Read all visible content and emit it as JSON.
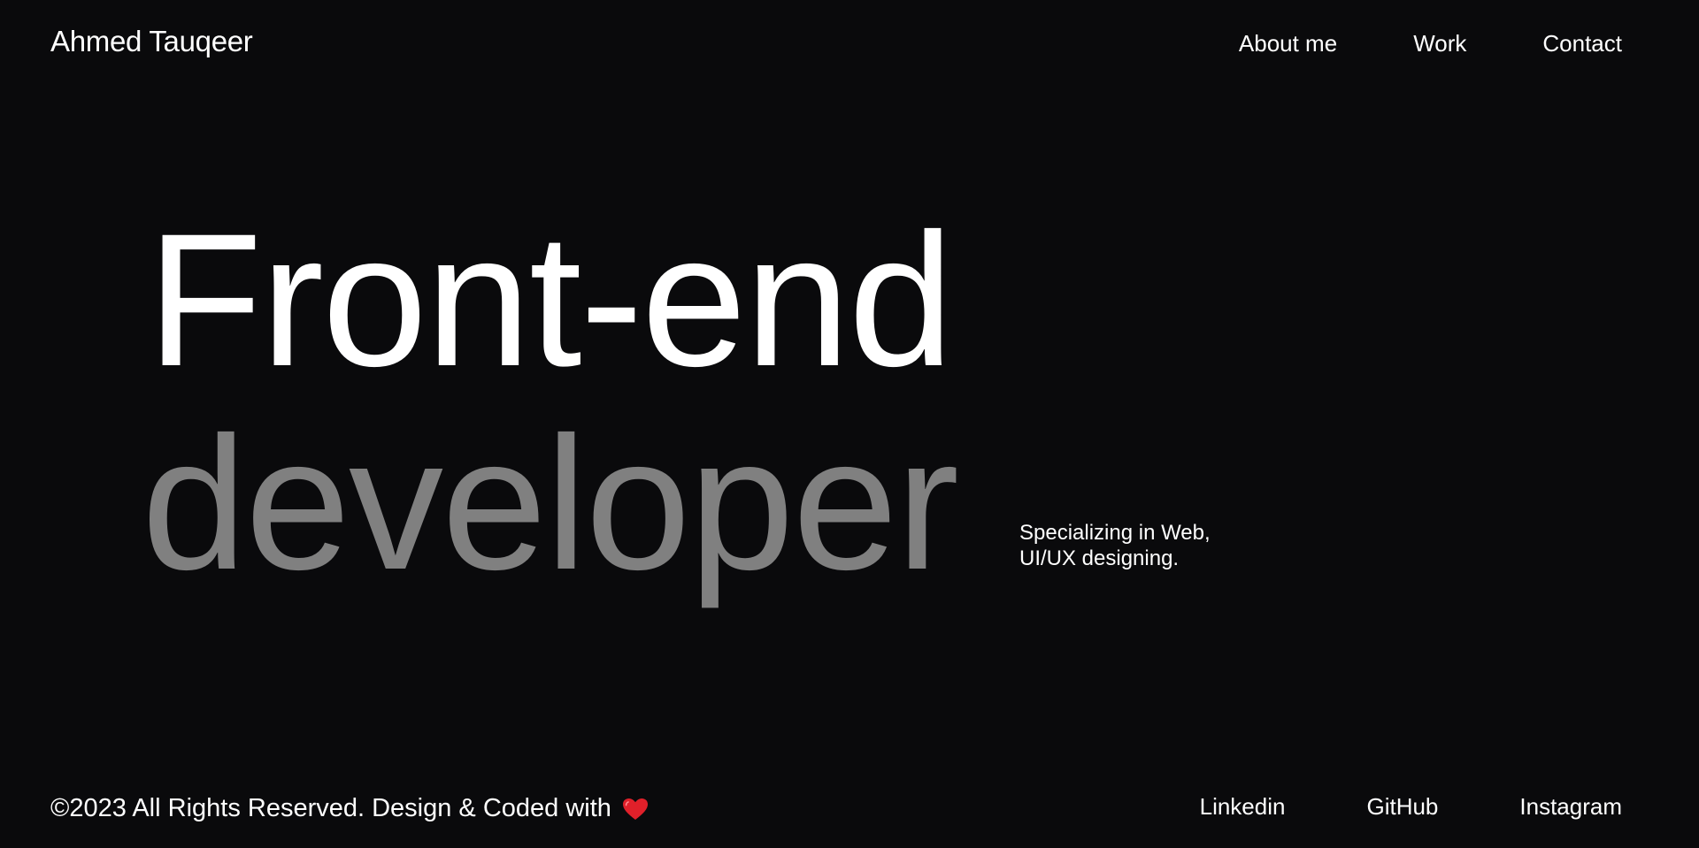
{
  "header": {
    "brand": "Ahmed Tauqeer",
    "nav": [
      {
        "label": "About me"
      },
      {
        "label": "Work"
      },
      {
        "label": "Contact"
      }
    ]
  },
  "hero": {
    "line1": "Front-end",
    "line2": "developer",
    "tagline_line1": "Specializing in Web,",
    "tagline_line2": "UI/UX designing."
  },
  "footer": {
    "copyright": "©2023 All Rights Reserved. Design & Coded with",
    "heart_icon": "heart-icon",
    "social": [
      {
        "label": "Linkedin"
      },
      {
        "label": "GitHub"
      },
      {
        "label": "Instagram"
      }
    ]
  },
  "colors": {
    "background": "#0a0a0c",
    "primary_text": "#ffffff",
    "muted_text": "#808080",
    "heart": "#e0202a"
  }
}
